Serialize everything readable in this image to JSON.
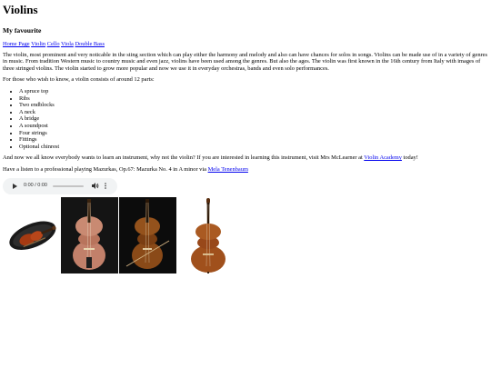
{
  "header": {
    "title": "Violins",
    "subtitle": "My favourite"
  },
  "nav": {
    "links": [
      "Home Page",
      "Violin",
      "Cello",
      "Viola",
      "Double Bass"
    ]
  },
  "intro": "The violin, most prominent and very noticable in the sting section which can play either the harmony and melody and also can have chances for solos in songs. Violins can be made use of in a variety of genres in music. From tradition Western music to country music and even jazz, violins have been used among the genres. But also the ages. The violin was first known in the 16th century from Italy with images of three stringed violins. The violin started to grow more popular and now we use it in everyday orchestras, bands and even solo performances.",
  "parts": {
    "lead": "For those who wish to know, a violin consists of around 12 parts:",
    "items": [
      "A spruce top",
      "Ribs",
      "Two endblocks",
      "A neck",
      "A bridge",
      "A soundpost",
      "Four strings",
      "Fittings",
      "Optional chinrest"
    ]
  },
  "learn": {
    "text": "And now we all know everybody wants to learn an instrument, why not the violin? If you are interested in learning this instrument, visit Mrs McLearner at ",
    "link": "Violin Academy",
    "after": " today!"
  },
  "listen": {
    "text": "Have a listen to a professional playing Mazurkas, Op.67: Mazurka No. 4 in A minor via ",
    "link": "Mela Tenenbaum"
  },
  "audio": {
    "time": "0:00 / 0:00"
  },
  "icons": {
    "play": "play-icon",
    "volume": "volume-icon",
    "more": "more-options-icon",
    "gallery": [
      "violin-case-image",
      "cello-dark-image",
      "violin-dark-image",
      "double-bass-image"
    ]
  },
  "colors": {
    "link": "#0000ee",
    "audio_bg": "#f1f3f4",
    "wood": "#a0501c"
  }
}
